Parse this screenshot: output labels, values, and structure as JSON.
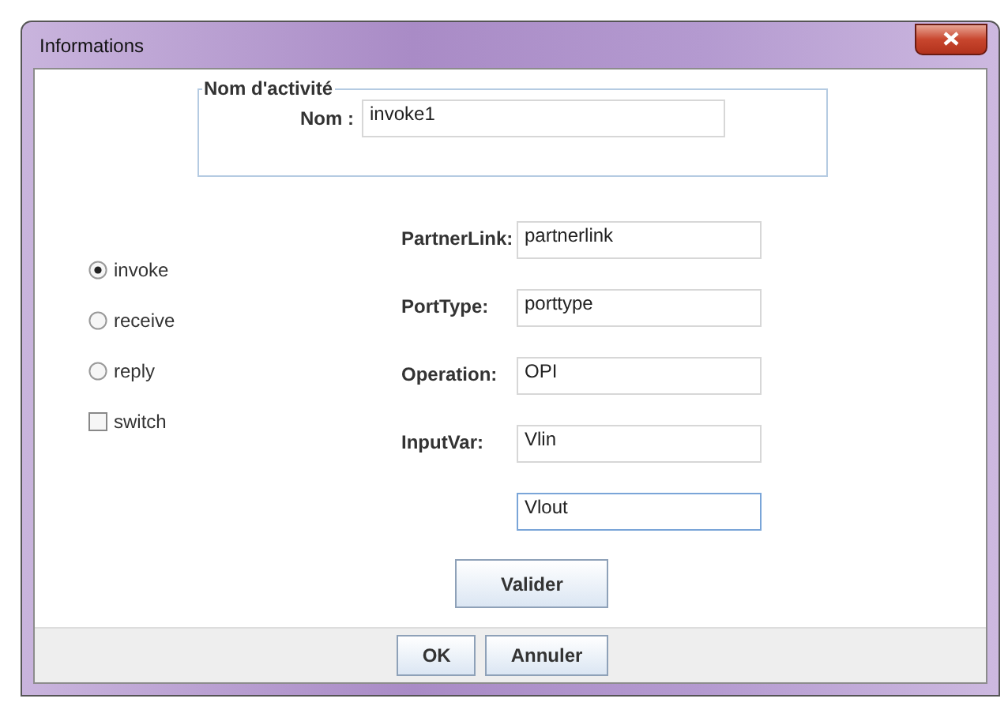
{
  "window": {
    "title": "Informations"
  },
  "activity_group": {
    "legend": "Nom d'activité",
    "name_label": "Nom :",
    "name_value": "invoke1"
  },
  "activity_types": [
    {
      "kind": "radio",
      "label": "invoke",
      "checked": true
    },
    {
      "kind": "radio",
      "label": "receive",
      "checked": false
    },
    {
      "kind": "radio",
      "label": "reply",
      "checked": false
    },
    {
      "kind": "checkbox",
      "label": "switch",
      "checked": false
    }
  ],
  "fields": [
    {
      "label": "PartnerLink:",
      "value": "partnerlink",
      "focused": false
    },
    {
      "label": "PortType:",
      "value": "porttype",
      "focused": false
    },
    {
      "label": "Operation:",
      "value": "OPI",
      "focused": false
    },
    {
      "label": "InputVar:",
      "value": "Vlin",
      "focused": false
    },
    {
      "value": "Vlout",
      "focused": true
    }
  ],
  "validate_button": "Valider",
  "buttons": [
    "OK",
    "Annuler"
  ]
}
